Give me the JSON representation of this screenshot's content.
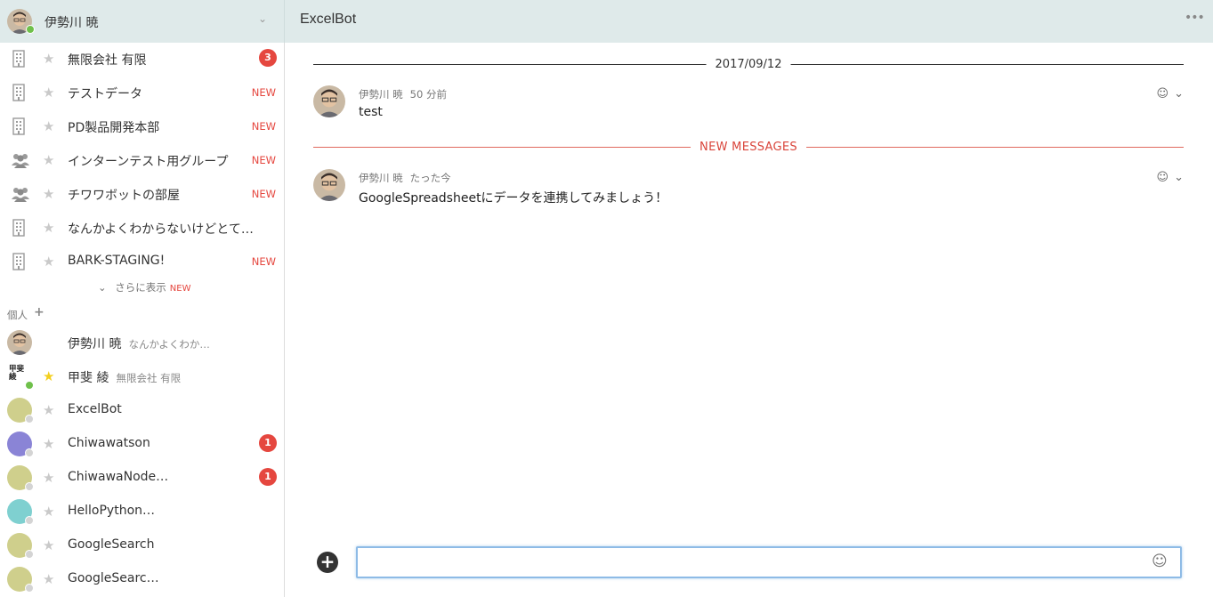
{
  "current_user": {
    "name": "伊勢川 暁"
  },
  "channel": {
    "title": "ExcelBot",
    "more_icon": "•••"
  },
  "icons": {
    "star": "★",
    "caret": "⌄",
    "emoji": "☺",
    "chevron": "⌄",
    "plus": "+",
    "show_more_chevron": "⌄"
  },
  "colors": {
    "accent_red": "#e5473f",
    "online": "#6fc04b",
    "topbar": "#dfeaea",
    "input_focus": "#8ebbe6"
  },
  "groups": [
    {
      "icon": "building-icon",
      "label": "無限会社 有限",
      "badge": "3",
      "new": ""
    },
    {
      "icon": "building-icon",
      "label": "テストデータ",
      "badge": "",
      "new": "NEW"
    },
    {
      "icon": "building-icon",
      "label": "PD製品開発本部",
      "badge": "",
      "new": "NEW"
    },
    {
      "icon": "group-icon",
      "label": "インターンテスト用グループ",
      "badge": "",
      "new": "NEW"
    },
    {
      "icon": "group-icon",
      "label": "チワワボットの部屋",
      "badge": "",
      "new": "NEW"
    },
    {
      "icon": "building-icon",
      "label": "なんかよくわからないけどとて…",
      "badge": "",
      "new": ""
    },
    {
      "icon": "building-icon",
      "label": "BARK-STAGING!",
      "badge": "",
      "new": "NEW"
    }
  ],
  "show_more": {
    "label": "さらに表示",
    "new": "NEW"
  },
  "personal_section": {
    "label": "個人",
    "add": "+"
  },
  "dms": [
    {
      "label": "伊勢川 暁",
      "sub": "なんかよくわか…",
      "badge": "",
      "avatar_color": "#b89a7a",
      "starred": false
    },
    {
      "label": "甲斐 綾",
      "sub": "無限会社 有限",
      "badge": "",
      "avatar_text": "甲斐\n綾",
      "starred": true
    },
    {
      "label": "ExcelBot",
      "sub": "",
      "badge": "",
      "avatar_color": "#cfcf8c",
      "starred": false
    },
    {
      "label": "Chiwawatson",
      "sub": "",
      "badge": "1",
      "avatar_color": "#8a84d6",
      "starred": false
    },
    {
      "label": "ChiwawaNode…",
      "sub": "",
      "badge": "1",
      "avatar_color": "#cfcf8c",
      "starred": false
    },
    {
      "label": "HelloPython…",
      "sub": "",
      "badge": "",
      "avatar_color": "#7fd0d0",
      "starred": false
    },
    {
      "label": "GoogleSearch",
      "sub": "",
      "badge": "",
      "avatar_color": "#cfcf8c",
      "starred": false
    },
    {
      "label": "GoogleSearc…",
      "sub": "",
      "badge": "",
      "avatar_color": "#cfcf8c",
      "starred": false
    }
  ],
  "date_divider": "2017/09/12",
  "new_divider": "NEW MESSAGES",
  "messages": [
    {
      "author": "伊勢川 暁",
      "time": "50 分前",
      "body": "test"
    },
    {
      "author": "伊勢川 暁",
      "time": "たった今",
      "body": "GoogleSpreadsheetにデータを連携してみましょう！"
    }
  ],
  "composer": {
    "value": "",
    "placeholder": ""
  }
}
